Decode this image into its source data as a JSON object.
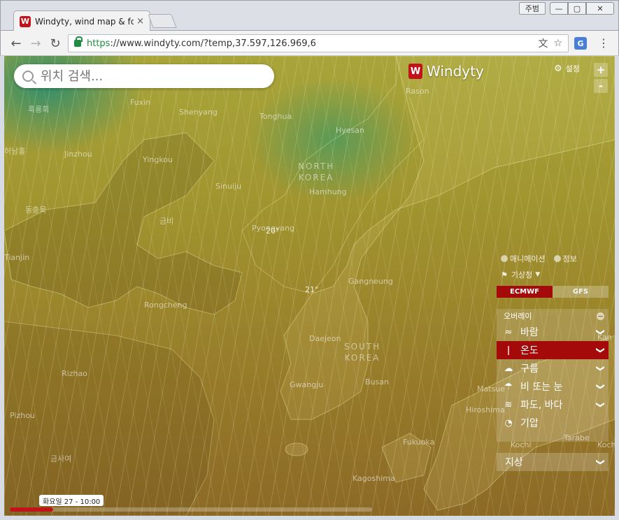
{
  "browser": {
    "tab_title": "Windyty, wind map & fc",
    "tab_close": "×",
    "user_badge": "주범",
    "win_min": "—",
    "win_max": "▢",
    "win_close": "✕",
    "url_proto": "https",
    "url_rest": "://www.windyty.com/?temp,37.597,126.969,6",
    "back": "←",
    "forward": "→",
    "reload": "↻",
    "translate_icon": "文",
    "star_icon": "☆",
    "menu_icon": "⋮"
  },
  "app": {
    "logo_mark": "W",
    "logo_text": "Windyty",
    "search_placeholder": "위치 검색...",
    "settings_label": "설정",
    "zoom_in": "+",
    "zoom_out": "-",
    "animation_label": "애니메이션",
    "info_label": "정보",
    "source_label": "기상청",
    "models": [
      "ECMWF",
      "GFS"
    ],
    "active_model": "ECMWF",
    "overlay_title": "오버레이",
    "overlays": [
      {
        "label": "바람",
        "icon": "wind-icon",
        "glyph": "≈",
        "active": false
      },
      {
        "label": "온도",
        "icon": "thermometer-icon",
        "glyph": "🌡",
        "active": true
      },
      {
        "label": "구름",
        "icon": "cloud-icon",
        "glyph": "☁",
        "active": false
      },
      {
        "label": "비 또는 눈",
        "icon": "rain-icon",
        "glyph": "☂",
        "active": false
      },
      {
        "label": "파도, 바다",
        "icon": "waves-icon",
        "glyph": "≋",
        "active": false
      },
      {
        "label": "기압",
        "icon": "pressure-gauge-icon",
        "glyph": "◔",
        "active": false
      }
    ],
    "ground_label": "지상",
    "chevron": "❯",
    "time_label": "화요일 27 - 10:00",
    "timeline_progress": 0.12
  },
  "map": {
    "labels": [
      {
        "text": "Fuxin"
      },
      {
        "text": "Shenyang"
      },
      {
        "text": "Tonghua"
      },
      {
        "text": "Hyesan"
      },
      {
        "text": "Rason"
      },
      {
        "text": "Jinzhou"
      },
      {
        "text": "Yingkou"
      },
      {
        "text": "Sinuiju"
      },
      {
        "text": "Hamhung"
      },
      {
        "text": "Tianjin"
      },
      {
        "text": "Pyongyang"
      },
      {
        "text": "Gangneung"
      },
      {
        "text": "Rongcheng"
      },
      {
        "text": "Daejeon"
      },
      {
        "text": "Rizhao"
      },
      {
        "text": "Busan"
      },
      {
        "text": "Gwangju"
      },
      {
        "text": "Pizhou"
      },
      {
        "text": "Hiroshima"
      },
      {
        "text": "Fukuoka"
      },
      {
        "text": "Kochi"
      },
      {
        "text": "Kagoshima"
      },
      {
        "text": "Tarabe"
      },
      {
        "text": "Kan"
      },
      {
        "text": "Kochi"
      },
      {
        "text": "Matsue"
      }
    ],
    "korean_labels": [
      {
        "text": "흑룡회"
      },
      {
        "text": "금비"
      },
      {
        "text": "동충묵"
      },
      {
        "text": "허남홍"
      },
      {
        "text": "금사여"
      }
    ],
    "countries": [
      {
        "text": "NORTH\nKOREA"
      },
      {
        "text": "SOUTH\nKOREA"
      }
    ],
    "temps": [
      {
        "text": "20°"
      },
      {
        "text": "21°"
      }
    ]
  }
}
